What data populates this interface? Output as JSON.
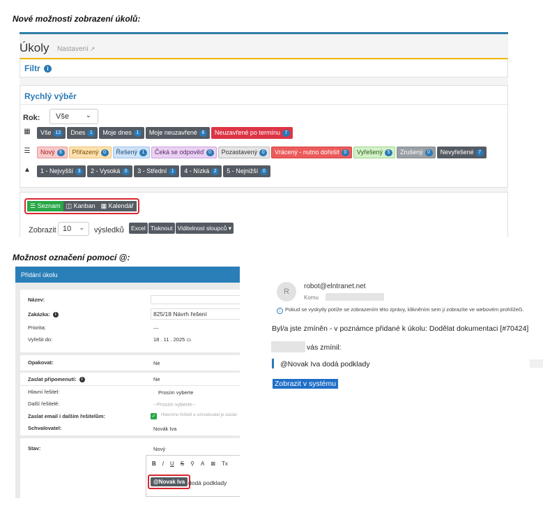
{
  "captions": {
    "top": "Nové možnosti zobrazení úkolů:",
    "bottom": "Možnost označení pomocí @:"
  },
  "app": {
    "title": "Úkoly",
    "settings": "Nastavení",
    "settings_icon": "external-link-icon"
  },
  "filter": {
    "label": "Filtr",
    "icon": "info-icon"
  },
  "quick": {
    "title": "Rychlý výběr",
    "year_label": "Rok:",
    "year_value": "Vše",
    "row1": [
      {
        "label": "Vše",
        "count": "12"
      },
      {
        "label": "Dnes",
        "count": "1"
      },
      {
        "label": "Moje dnes",
        "count": "1"
      },
      {
        "label": "Moje neuzavřené",
        "count": "6"
      },
      {
        "label": "Neuzavřené po termínu",
        "count": "7"
      }
    ],
    "row2": [
      {
        "label": "Nový",
        "count": "6"
      },
      {
        "label": "Přiřazený",
        "count": "0"
      },
      {
        "label": "Řešený",
        "count": "1"
      },
      {
        "label": "Čeká se odpověď",
        "count": "0"
      },
      {
        "label": "Pozastavený",
        "count": "0"
      },
      {
        "label": "Vrácený - nutno dořešit",
        "count": "0"
      },
      {
        "label": "Vyřešený",
        "count": "5"
      },
      {
        "label": "Zrušený",
        "count": "0"
      },
      {
        "label": "Nevyřešené",
        "count": "7"
      }
    ],
    "row3": [
      {
        "label": "1 - Nejvyšší",
        "count": "3"
      },
      {
        "label": "2 - Vysoká",
        "count": "0"
      },
      {
        "label": "3 - Střední",
        "count": "1"
      },
      {
        "label": "4 - Nízká",
        "count": "2"
      },
      {
        "label": "5 - Nejnižší",
        "count": "0"
      }
    ],
    "colors": {
      "row2": [
        {
          "bg": "#f8c9c9",
          "fg": "#a61c1c",
          "border": "#e89999"
        },
        {
          "bg": "#fde2b0",
          "fg": "#7a4a00",
          "border": "#f0c070"
        },
        {
          "bg": "#cfe3f7",
          "fg": "#1a4c7a",
          "border": "#9cc3ea"
        },
        {
          "bg": "#ead1f2",
          "fg": "#5c2a6e",
          "border": "#cfa2df"
        },
        {
          "bg": "#e6e6e6",
          "fg": "#333333",
          "border": "#bbbbbb"
        },
        {
          "bg": "#ec5b5b",
          "fg": "#ffffff",
          "border": "#d84444"
        },
        {
          "bg": "#d4f1c9",
          "fg": "#2a6018",
          "border": "#9ed68a"
        },
        {
          "bg": "#9a9fa4",
          "fg": "#ffffff",
          "border": "#8a8f94"
        },
        {
          "bg": "#555b62",
          "fg": "#ffffff",
          "border": "#555b62"
        }
      ]
    }
  },
  "views": {
    "buttons": [
      {
        "label": "Seznam",
        "icon": "list-icon",
        "glyph": "☰"
      },
      {
        "label": "Kanban",
        "icon": "columns-icon",
        "glyph": "◫"
      },
      {
        "label": "Kalendář",
        "icon": "calendar-icon",
        "glyph": "▦"
      }
    ],
    "show_label": "Zobrazit",
    "show_value": "10",
    "results_label": "výsledků",
    "tools": [
      "Excel",
      "Tisknout",
      "Viditelnost sloupců ▾"
    ]
  },
  "form": {
    "title": "Přidání úkolu",
    "fields": {
      "name": "Název:",
      "order": "Zakázka:",
      "order_value": "825/18 Návrh řešení",
      "priority": "Priorita:",
      "priority_value": "---",
      "due": "Vyřešit do:",
      "due_value": "18 . 11 . 2025",
      "repeat": "Opakovat:",
      "repeat_value": "Ne",
      "remind": "Zaslat připomenutí:",
      "remind_value": "Ne",
      "main": "Hlavní řešitel:",
      "main_value": "Prosím vyberte",
      "other": "Další řešitelé:",
      "other_value": "--Prosím vyberte--",
      "email": "Zaslat email i dalším řešitelům:",
      "email_value": "Hlavnímu řešiteli a schvalovatel je zaslán",
      "approver": "Schvalovatel:",
      "approver_value": "Novák Iva",
      "state": "Stav:",
      "state_value": "Nový"
    },
    "editor": {
      "toolbar": [
        "B",
        "I",
        "U",
        "S",
        "⚲",
        "A",
        "⊠",
        "Tx"
      ],
      "mention": "@Novak Iva",
      "rest": "dodá podklady"
    }
  },
  "email": {
    "avatar": "R",
    "sender": "robot@elntranet.net",
    "to_label": "Komu",
    "note": "Pokud se vyskytly potíže se zobrazením této zprávy, klikněním sem ji zobrazíte ve webovém prohlížeči.",
    "line": "Byl/a jste zmíněn - v poznámce přidané k úkolu: Dodělat dokumentaci [#70424]",
    "mentioned": "vás zmínil:",
    "quote": "@Novak Iva dodá podklady",
    "link": "Zobrazit v systému"
  }
}
